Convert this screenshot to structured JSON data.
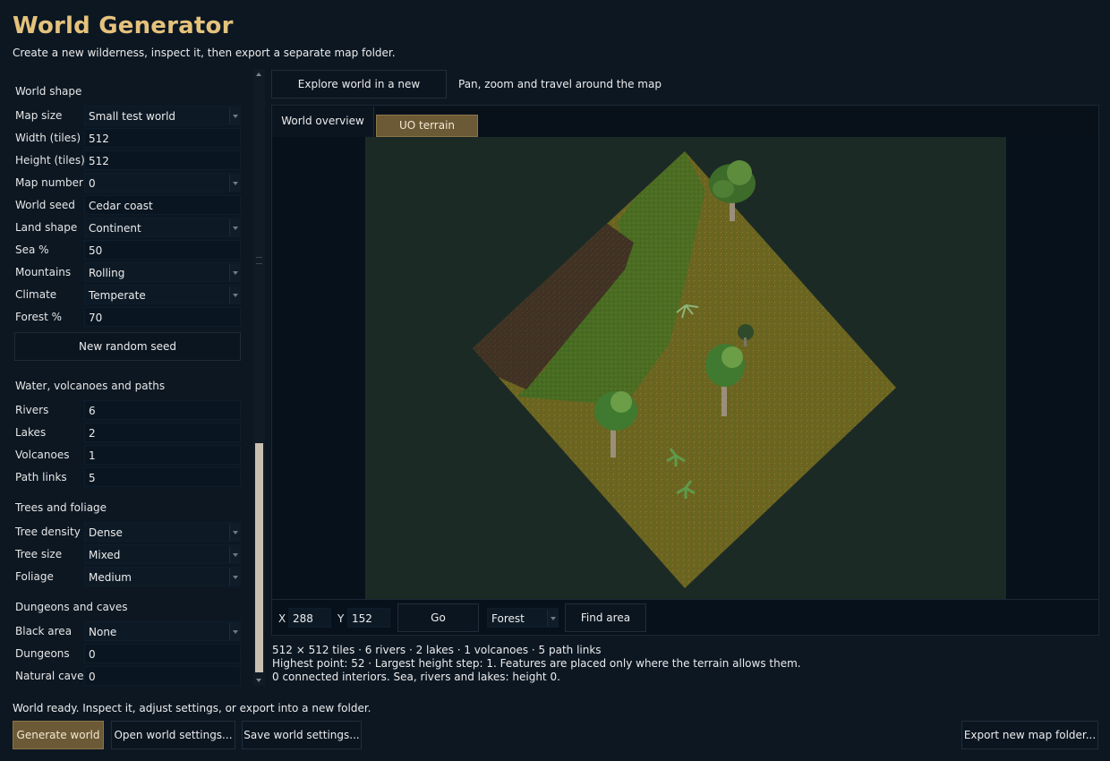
{
  "app": {
    "title": "World Generator",
    "subtitle": "Create a new wilderness, inspect it, then export a separate map folder."
  },
  "world_shape": {
    "title": "World shape",
    "fields": [
      {
        "label": "Map size",
        "value": "Small test world",
        "kind": "dropdown"
      },
      {
        "label": "Width (tiles)",
        "value": "512",
        "kind": "input"
      },
      {
        "label": "Height (tiles)",
        "value": "512",
        "kind": "input"
      },
      {
        "label": "Map number",
        "value": "0",
        "kind": "dropdown"
      },
      {
        "label": "World seed",
        "value": "Cedar coast",
        "kind": "input"
      },
      {
        "label": "Land shape",
        "value": "Continent",
        "kind": "dropdown"
      },
      {
        "label": "Sea %",
        "value": "50",
        "kind": "input"
      },
      {
        "label": "Mountains",
        "value": "Rolling",
        "kind": "dropdown"
      },
      {
        "label": "Climate",
        "value": "Temperate",
        "kind": "dropdown"
      },
      {
        "label": "Forest %",
        "value": "70",
        "kind": "input"
      }
    ],
    "seed_button": "New random seed"
  },
  "water": {
    "title": "Water, volcanoes and paths",
    "fields": [
      {
        "label": "Rivers",
        "value": "6",
        "kind": "input"
      },
      {
        "label": "Lakes",
        "value": "2",
        "kind": "input"
      },
      {
        "label": "Volcanoes",
        "value": "1",
        "kind": "input"
      },
      {
        "label": "Path links",
        "value": "5",
        "kind": "input"
      }
    ]
  },
  "trees": {
    "title": "Trees and foliage",
    "fields": [
      {
        "label": "Tree density",
        "value": "Dense",
        "kind": "dropdown"
      },
      {
        "label": "Tree size",
        "value": "Mixed",
        "kind": "dropdown"
      },
      {
        "label": "Foliage",
        "value": "Medium",
        "kind": "dropdown"
      }
    ]
  },
  "dungeons": {
    "title": "Dungeons and caves",
    "fields": [
      {
        "label": "Black area",
        "value": "None",
        "kind": "dropdown"
      },
      {
        "label": "Dungeons",
        "value": "0",
        "kind": "input"
      },
      {
        "label": "Natural caves",
        "value": "0",
        "kind": "input"
      }
    ]
  },
  "explore": {
    "button": "Explore world in a new window...",
    "hint": "Pan, zoom and travel around the map"
  },
  "tabs": {
    "overview": "World overview",
    "preview": "UO terrain preview",
    "active": "preview"
  },
  "coords": {
    "x_label": "X",
    "x_value": "288",
    "y_label": "Y",
    "y_value": "152",
    "go": "Go",
    "area_type": "Forest",
    "find": "Find area"
  },
  "stats": {
    "line1": "512 × 512 tiles · 6 rivers · 2 lakes · 1 volcanoes · 5 path links",
    "line2": "Highest point: 52 · Largest height step: 1. Features are placed only where the terrain allows them.",
    "line3": "0 connected interiors. Sea, rivers and lakes: height 0."
  },
  "status": "World ready. Inspect it, adjust settings, or export into a new folder.",
  "actions": {
    "generate": "Generate world",
    "open": "Open world settings...",
    "save": "Save world settings...",
    "export": "Export new map folder..."
  },
  "colors": {
    "accent": "#e5c27c",
    "primary_button": "#6c5a36",
    "background": "#0c1722"
  }
}
